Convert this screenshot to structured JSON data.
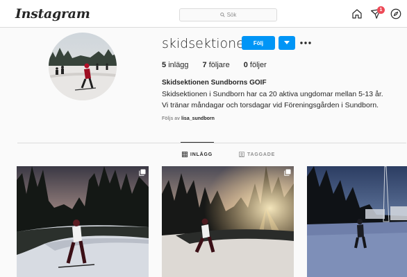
{
  "header": {
    "logo": "Instagram",
    "search_placeholder": "Sök",
    "notification_count": "1",
    "icons": [
      "home-icon",
      "activity-heart-icon",
      "explore-compass-icon"
    ]
  },
  "profile": {
    "username": "skidsektionen",
    "follow_label": "Följ",
    "stats": {
      "posts_count": "5",
      "posts_label": "inlägg",
      "followers_count": "7",
      "followers_label": "följare",
      "following_count": "0",
      "following_label": "följer"
    },
    "full_name": "Skidsektionen Sundborns GOIF",
    "bio_line1": "Skidsektionen i Sundborn har ca 20 aktiva ungdomar mellan 5-13 år.",
    "bio_line2": "Vi tränar måndagar och torsdagar vid Föreningsgården i Sundborn.",
    "followed_by_prefix": "Följs av",
    "followed_by_user": "lisa_sundborn"
  },
  "tabs": [
    {
      "label": "INLÄGG",
      "active": true
    },
    {
      "label": "TAGGADE",
      "active": false
    }
  ],
  "colors": {
    "accent": "#0095f6",
    "badge": "#ed4956"
  }
}
